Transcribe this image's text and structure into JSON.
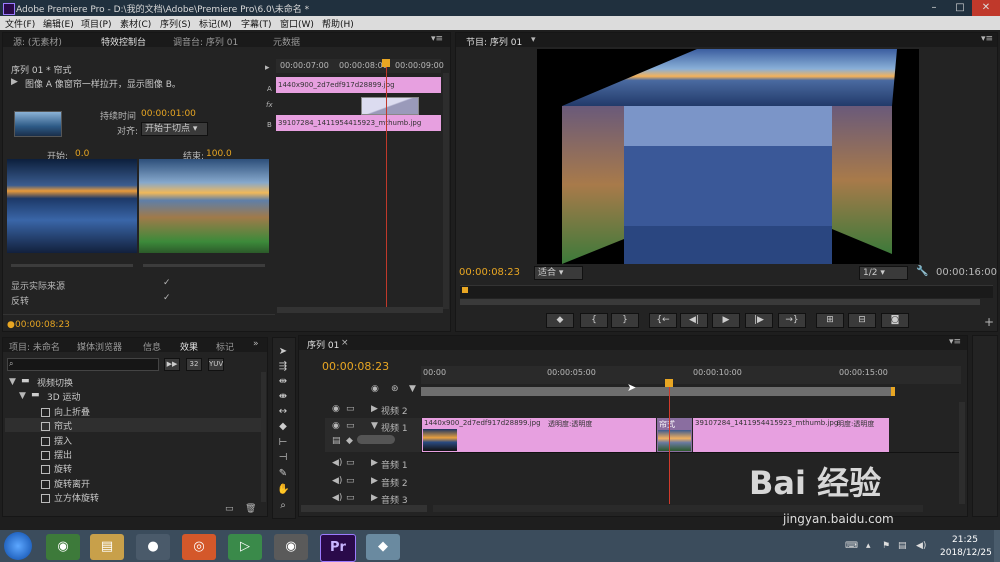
{
  "window": {
    "title": "Adobe Premiere Pro - D:\\我的文档\\Adobe\\Premiere Pro\\6.0\\未命名 *"
  },
  "menu": [
    "文件(F)",
    "编辑(E)",
    "项目(P)",
    "素材(C)",
    "序列(S)",
    "标记(M)",
    "字幕(T)",
    "窗口(W)",
    "帮助(H)"
  ],
  "effect_panel": {
    "tabs": [
      "源: (无素材)",
      "特效控制台",
      "调音台: 序列 01",
      "元数据"
    ],
    "header": "序列 01 * 帘式",
    "description": "图像 A 像窗帘一样拉开，显示图像 B。",
    "duration_label": "持续时间",
    "duration_value": "00:00:01:00",
    "align_label": "对齐:",
    "align_value": "开始于切点",
    "start_label": "开始:",
    "start_value": "0.0",
    "end_label": "结束:",
    "end_value": "100.0",
    "show_source": "显示实际来源",
    "reverse": "反转",
    "timecode": "00:00:08:23",
    "ruler": [
      "00:00:07:00",
      "00:00:08:00",
      "00:00:09:00"
    ],
    "track_a": "A",
    "track_b": "B",
    "fx": "fx",
    "clip_a": "1440x900_2d7edf917d28899.jpg",
    "clip_b": "39107284_1411954415923_mthumb.jpg"
  },
  "program": {
    "tab": "节目: 序列 01",
    "current": "00:00:08:23",
    "fit": "适合",
    "ratio": "1/2",
    "duration": "00:00:16:00"
  },
  "project_panel": {
    "tabs": [
      "项目: 未命名",
      "媒体浏览器",
      "信息",
      "效果",
      "标记"
    ],
    "tree": [
      "视频切换",
      "3D 运动",
      "向上折叠",
      "帘式",
      "摆入",
      "摆出",
      "旋转",
      "旋转离开",
      "立方体旋转"
    ]
  },
  "timeline": {
    "tab": "序列 01",
    "timecode": "00:00:08:23",
    "ruler": [
      "00:00",
      "00:00:05:00",
      "00:00:10:00",
      "00:00:15:00"
    ],
    "tracks": [
      "视频 2",
      "视频 1",
      "音频 1",
      "音频 2",
      "音频 3"
    ],
    "clip1": "1440x900_2d7edf917d28899.jpg",
    "clip1_fx": "透明度:透明度",
    "transition": "帘式",
    "clip2": "39107284_1411954415923_mthumb.jpg",
    "clip2_fx": "明度:透明度"
  },
  "taskbar": {
    "time": "21:25",
    "date": "2018/12/25",
    "app_label": "Pr"
  },
  "watermark": {
    "logo": "Bai 经验",
    "url": "jingyan.baidu.com"
  }
}
